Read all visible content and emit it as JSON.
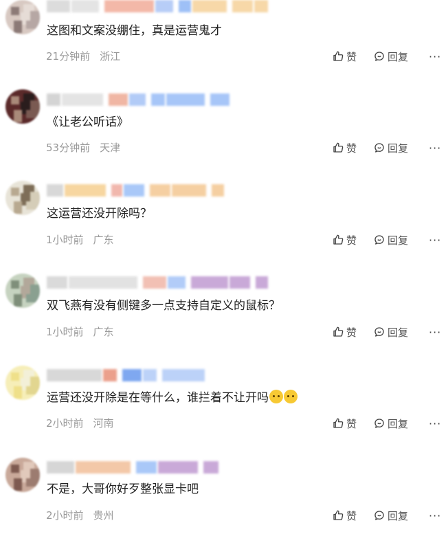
{
  "comments": [
    {
      "text": "这图和文案没绷住，真是运营鬼才",
      "time": "21分钟前",
      "location": "浙江",
      "avatar_colors": [
        "#d8c9c2",
        "#8c7a77",
        "#e6dcd6",
        "#b6a7a4"
      ],
      "name_colors": [
        "#dcdcdc",
        "#e4e4e4",
        "#f3b8a8",
        "#b7cdf7",
        "#9ec0f7",
        "#f7d8a8"
      ]
    },
    {
      "text": "《让老公听话》",
      "time": "53分钟前",
      "location": "天津",
      "avatar_colors": [
        "#5b2a2a",
        "#a98a7a",
        "#2a1d1d",
        "#7a5a52"
      ],
      "name_colors": [
        "#d4d4d4",
        "#e4e4e4",
        "#f0b6a4",
        "#b2cbf7",
        "#a7c6f8"
      ]
    },
    {
      "text": "这运营还没开除吗？",
      "time": "1小时前",
      "location": "广东",
      "avatar_colors": [
        "#e8e4d8",
        "#b8a990",
        "#7e6e58",
        "#d5cdb8"
      ],
      "name_colors": [
        "#d8d8d8",
        "#f7d6a0",
        "#f1b7ad",
        "#a9c8f8",
        "#f5cfa2"
      ]
    },
    {
      "text": "双飞燕有没有侧键多一点支持自定义的鼠标？",
      "time": "1小时前",
      "location": "广东",
      "avatar_colors": [
        "#c6d3c0",
        "#7f8f7a",
        "#b2a89a",
        "#8aa090"
      ],
      "name_colors": [
        "#dadada",
        "#e2e2e2",
        "#f2c0b4",
        "#b2ccf8",
        "#c9a9d8"
      ]
    },
    {
      "text": "运营还没开除是在等什么，谁拦着不让开吗",
      "time": "2小时前",
      "location": "河南",
      "avatar_colors": [
        "#f6eeb8",
        "#efe08a",
        "#f3f0d8",
        "#e2d690"
      ],
      "name_colors": [
        "#d8d8d8",
        "#eba08c",
        "#7fa8f0",
        "#bcd2f8"
      ]
    },
    {
      "text": "不是，大哥你好歹整张显卡吧",
      "time": "2小时前",
      "location": "贵州",
      "avatar_colors": [
        "#c9a99a",
        "#7e5a50",
        "#e1c9bb",
        "#9c7c70"
      ],
      "name_colors": [
        "#d6d6d6",
        "#f3c8a8",
        "#a9c8f8",
        "#c9a9d8"
      ]
    }
  ],
  "actions": {
    "like": "赞",
    "reply": "回复",
    "more": "···"
  },
  "icons": {
    "like": "thumbs-up-icon",
    "reply": "chat-bubble-icon",
    "more": "ellipsis-icon"
  }
}
